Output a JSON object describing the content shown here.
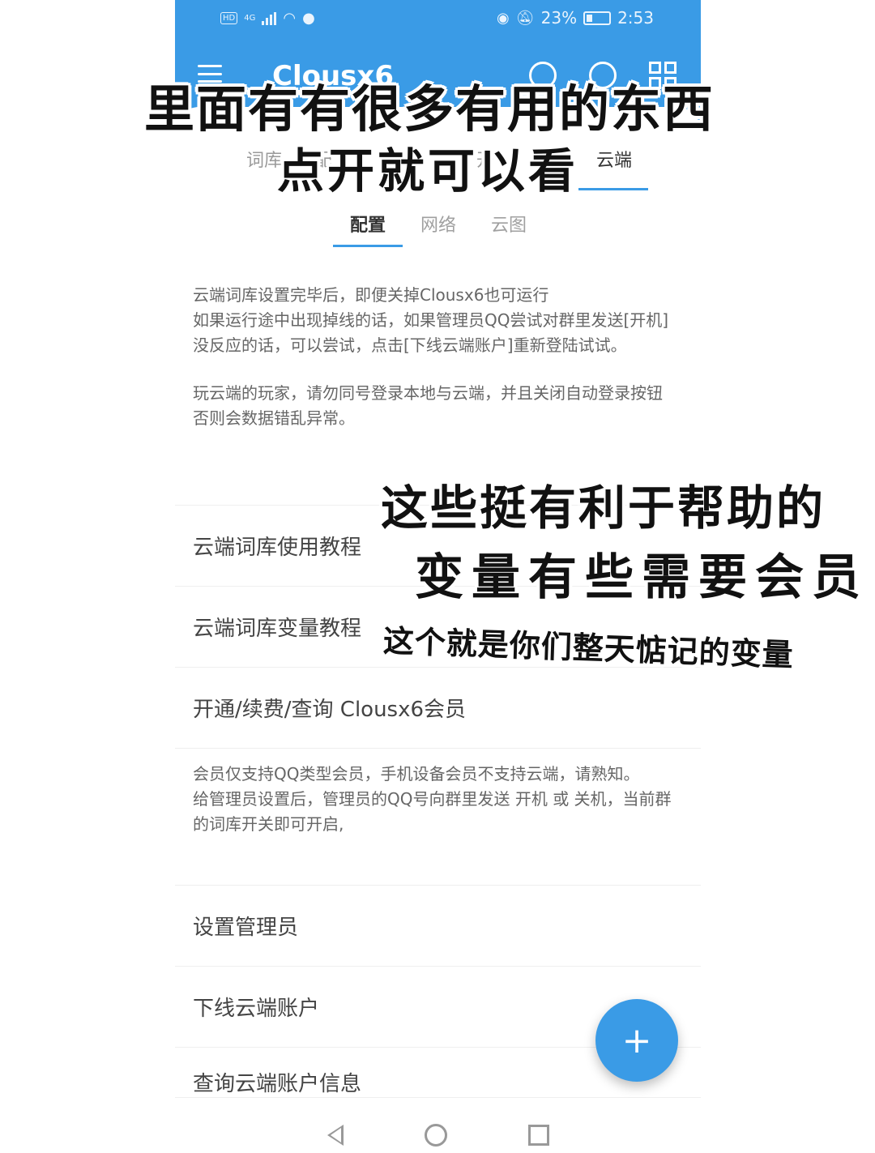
{
  "status_bar": {
    "hd": "HD",
    "network": "4G",
    "battery_percent": "23%",
    "time": "2:53",
    "icons": [
      "signal-icon",
      "wifi-icon",
      "qq-penguin-icon",
      "eye-icon",
      "mute-bell-icon",
      "battery-charging-icon"
    ]
  },
  "app_bar": {
    "title": "Clousx6",
    "icons": [
      "menu-icon",
      "refresh-icon",
      "search-icon",
      "grid-icon"
    ]
  },
  "top_tabs": [
    {
      "label": "词库",
      "active": false
    },
    {
      "label": "配",
      "active": false
    },
    {
      "label": "开",
      "active": false
    },
    {
      "label": "日志",
      "active": false
    },
    {
      "label": "云端",
      "active": true
    }
  ],
  "sub_tabs": [
    {
      "label": "配置",
      "active": true
    },
    {
      "label": "网络",
      "active": false
    },
    {
      "label": "云图",
      "active": false
    }
  ],
  "notice_top": {
    "para1": "云端词库设置完毕后，即便关掉Clousx6也可运行\n如果运行途中出现掉线的话，如果管理员QQ尝试对群里发送[开机]没反应的话，可以尝试，点击[下线云端账户]重新登陆试试。",
    "para2": "玩云端的玩家，请勿同号登录本地与云端，并且关闭自动登录按钮\n否则会数据错乱异常。"
  },
  "menu_a": [
    "云端词库使用教程",
    "云端词库变量教程",
    "开通/续费/查询 Clousx6会员"
  ],
  "notice_member": "会员仅支持QQ类型会员，手机设备会员不支持云端，请熟知。\n给管理员设置后，管理员的QQ号向群里发送 开机 或 关机，当前群的词库开关即可开启,",
  "menu_b": [
    "设置管理员",
    "下线云端账户",
    "查询云端账户信息"
  ],
  "fab": {
    "symbol": "+"
  },
  "nav_bar": {
    "icons": [
      "back-icon",
      "home-icon",
      "recents-icon"
    ]
  },
  "captions": {
    "cap1": "里面有有很多有用的东西",
    "cap2": "点开就可以看",
    "cap3": "这些挺有利于帮助的",
    "cap4": "变量有些需要会员",
    "cap5": "这个就是你们整天惦记的变量"
  },
  "colors": {
    "accent": "#3a9be6",
    "text": "#444444",
    "muted": "#9a9a9a"
  }
}
